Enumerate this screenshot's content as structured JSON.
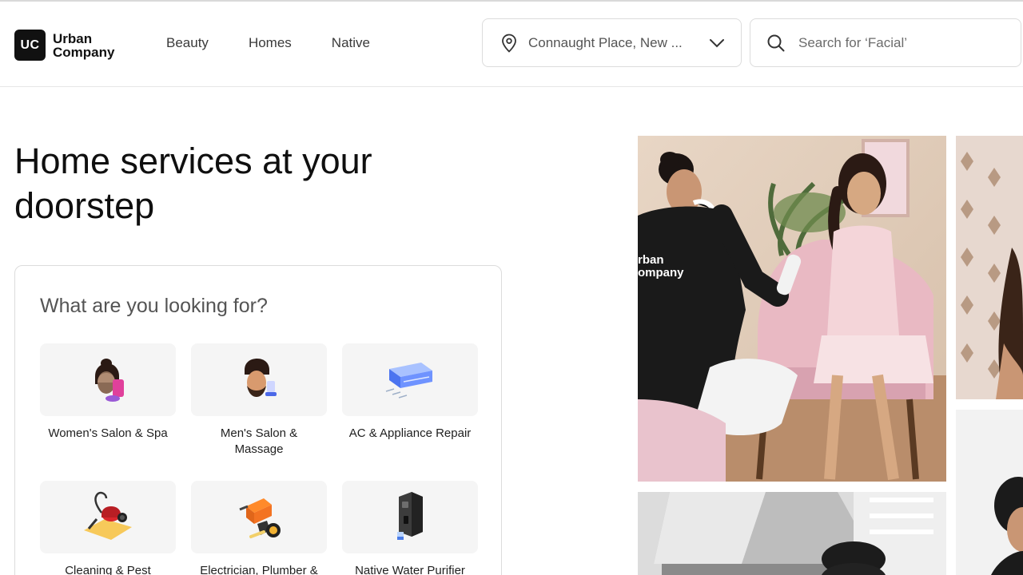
{
  "brand": {
    "badge": "UC",
    "line1": "Urban",
    "line2": "Company"
  },
  "nav": {
    "beauty": "Beauty",
    "homes": "Homes",
    "native": "Native"
  },
  "location": {
    "value": "Connaught Place, New ..."
  },
  "search": {
    "placeholder": "Search for ‘Facial’"
  },
  "hero": {
    "title": "Home services at your doorstep"
  },
  "services_panel": {
    "heading": "What are you looking for?",
    "items": [
      {
        "label": "Women's Salon & Spa",
        "icon": "women-salon-icon"
      },
      {
        "label": "Men's Salon & Massage",
        "icon": "men-salon-icon"
      },
      {
        "label": "AC & Appliance Repair",
        "icon": "ac-repair-icon"
      },
      {
        "label": "Cleaning & Pest",
        "icon": "cleaning-icon"
      },
      {
        "label": "Electrician, Plumber &",
        "icon": "electrician-icon"
      },
      {
        "label": "Native Water Purifier",
        "icon": "water-purifier-icon"
      }
    ]
  },
  "photo_text": {
    "uniform_brand": "rban\nompany"
  },
  "colors": {
    "accent": "#111111",
    "tile_bg": "#f5f5f5",
    "border": "#dcdcdc"
  }
}
